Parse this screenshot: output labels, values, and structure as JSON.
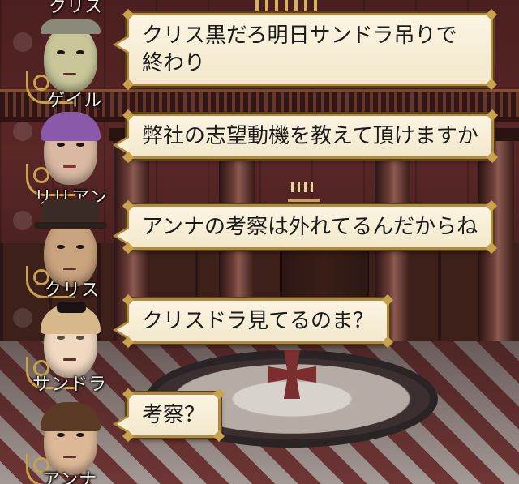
{
  "top_partial_name": "クリス",
  "messages": [
    {
      "speaker": "ゲイル",
      "text": "クリス黒だろ明日サンドラ吊りで終わり",
      "icon": "gail-avatar-icon",
      "face_color": "#c9c79a",
      "hair_color": "#8a8a7a"
    },
    {
      "speaker": "リリアン",
      "text": "弊社の志望動機を教えて頂けますか",
      "icon": "lillian-avatar-icon",
      "face_color": "#d9b9a2",
      "hair_color": "#8a5aa8"
    },
    {
      "speaker": "クリス",
      "text": "アンナの考察は外れてるんだからね",
      "icon": "chris-avatar-icon",
      "face_color": "#c9a27e",
      "hair_color": "#3a2a20"
    },
    {
      "speaker": "サンドラ",
      "text": "クリスドラ見てるのま？",
      "icon": "sandra-avatar-icon",
      "face_color": "#f1d8c0",
      "hair_color": "#d7b88a"
    },
    {
      "speaker": "アンナ",
      "text": "考察？",
      "icon": "anna-avatar-icon",
      "face_color": "#dcb896",
      "hair_color": "#5a3a22"
    }
  ],
  "colors": {
    "bubble_border": "#b08a3e",
    "bubble_fill": "#fbf4e2",
    "name_text": "#f2ecdf"
  }
}
